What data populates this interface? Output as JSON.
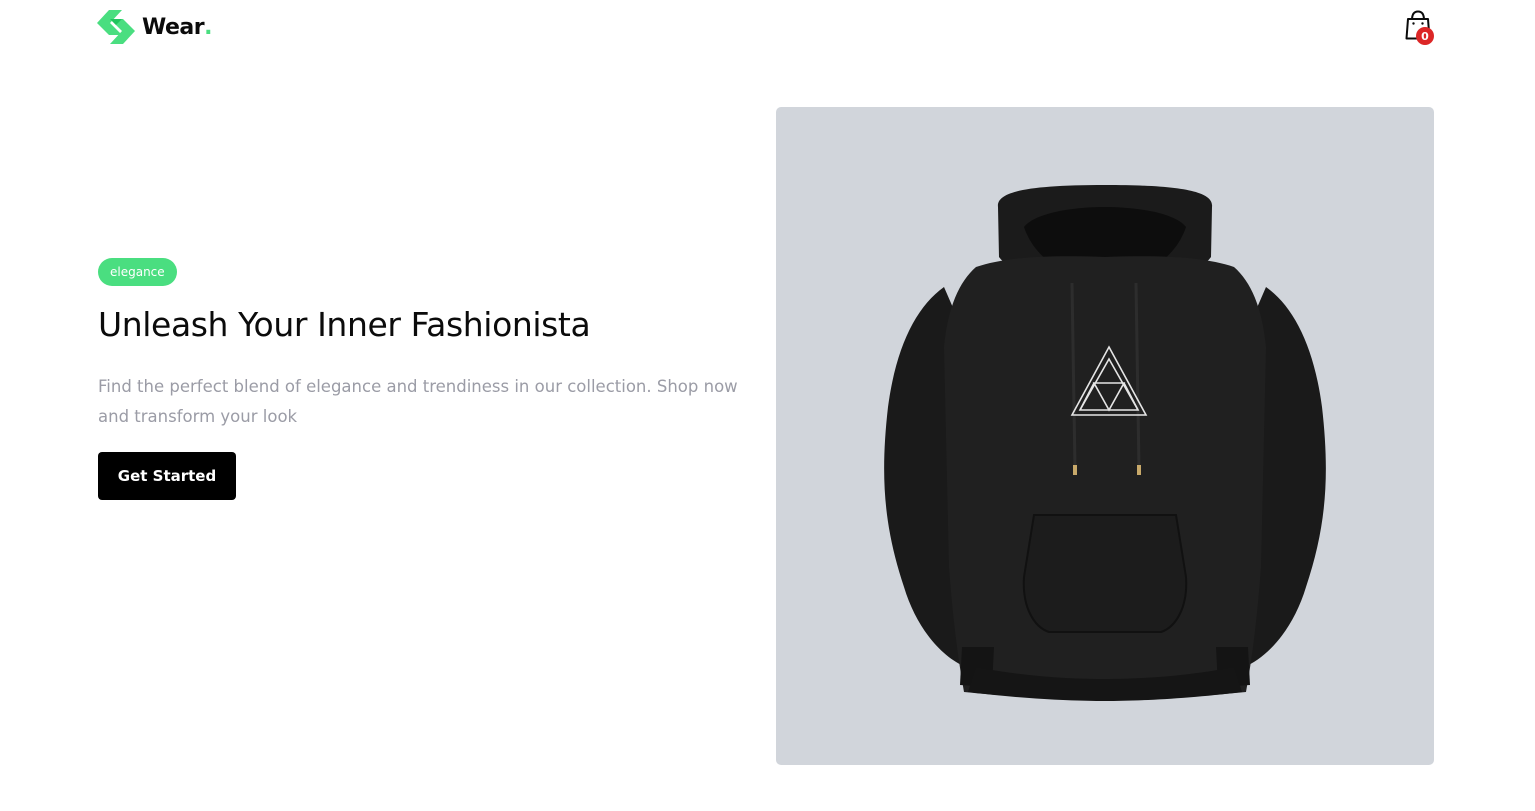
{
  "header": {
    "brand_name": "Wear",
    "brand_dot": ".",
    "cart_count": "0"
  },
  "hero": {
    "tag": "elegance",
    "headline": "Unleash Your Inner Fashionista",
    "subtext": "Find the perfect blend of elegance and trendiness in our collection. Shop now and transform your look",
    "cta_label": "Get Started",
    "image_alt": "black-hoodie-product-image"
  },
  "colors": {
    "brand_green": "#4ade80",
    "cart_badge": "#dc2626",
    "cta_bg": "#000000",
    "image_bg": "#d1d5db",
    "muted_text": "#9b9ca6"
  }
}
